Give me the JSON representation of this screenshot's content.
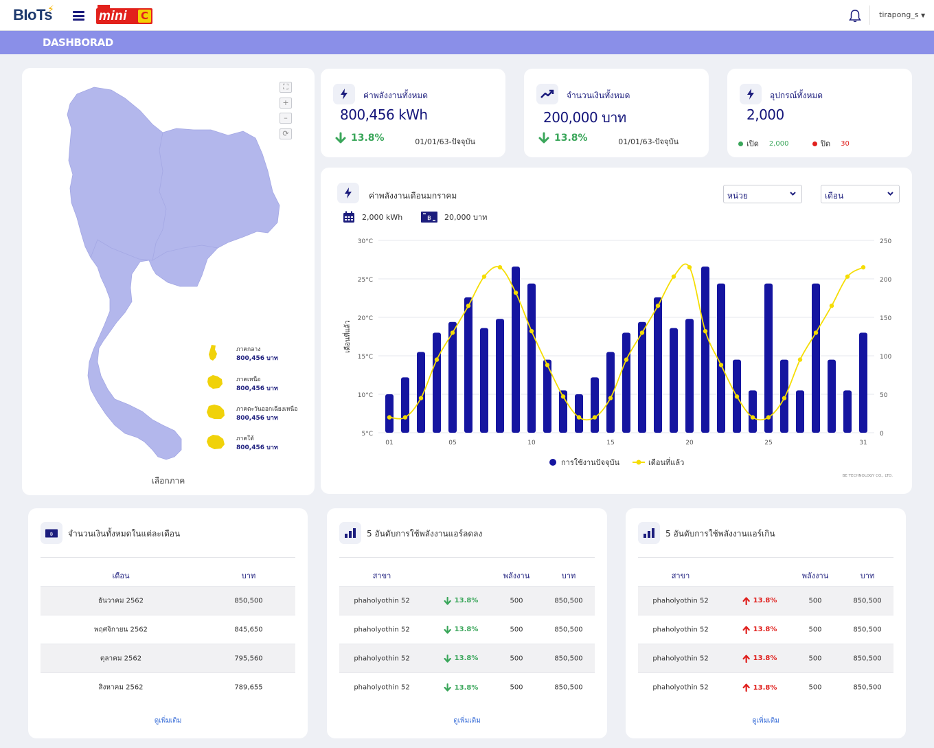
{
  "header": {
    "logo": "BIoTs",
    "brand_name": "mini",
    "brand_mark": "C",
    "username": "tirapong_s"
  },
  "section_title": "DASHBORAD",
  "map": {
    "caption": "เลือกภาค",
    "controls": [
      "⛶",
      "+",
      "–",
      "⟳"
    ],
    "regions": [
      {
        "name": "ภาคกลาง",
        "amount": "800,456 บาท"
      },
      {
        "name": "ภาคเหนือ",
        "amount": "800,456 บาท"
      },
      {
        "name": "ภาคตะวันออกเฉียงเหนือ",
        "amount": "800,456 บาท"
      },
      {
        "name": "ภาคใต้",
        "amount": "800,456 บาท"
      }
    ]
  },
  "stats": {
    "energy": {
      "label": "ค่าพลังงานทั้งหมด",
      "value": "800,456  kWh",
      "change": "13.8%",
      "period": "01/01/63-ปัจจุบัน"
    },
    "money": {
      "label": "จำนวนเงินทั้งหมด",
      "value": "200,000  บาท",
      "change": "13.8%",
      "period": "01/01/63-ปัจจุบัน"
    },
    "devices": {
      "label": "อุปกรณ์ทั้งหมด",
      "value": "2,000",
      "on_label": "เปิด",
      "on_value": "2,000",
      "off_label": "ปิด",
      "off_value": "30"
    }
  },
  "chart_panel": {
    "title": "ค่าพลังงานเดือนมกราคม",
    "unit_select": "หน่วย",
    "period_select": "เดือน",
    "summary_kwh": "2,000 kWh",
    "summary_baht": "20,000 บาท",
    "credit": "BE TECHNOLOGY CO., LTD."
  },
  "chart_data": {
    "type": "bar",
    "x_ticks": [
      "01",
      "05",
      "10",
      "15",
      "20",
      "25",
      "31"
    ],
    "x": [
      1,
      2,
      3,
      4,
      5,
      6,
      7,
      8,
      9,
      10,
      11,
      12,
      13,
      14,
      15,
      16,
      17,
      18,
      19,
      20,
      21,
      22,
      23,
      24,
      25,
      26,
      27,
      28,
      29,
      30,
      31
    ],
    "left_axis": {
      "label": "เดือนที่แล้ว",
      "ticks": [
        "5°C",
        "10°C",
        "15°C",
        "20°C",
        "25°C",
        "30°C"
      ],
      "range": [
        5,
        30
      ]
    },
    "right_axis": {
      "ticks": [
        "0",
        "50",
        "100",
        "150",
        "200",
        "250"
      ],
      "range": [
        0,
        250
      ]
    },
    "series": [
      {
        "name": "การใช้งานปัจจุบัน",
        "kind": "bar",
        "axis": "right",
        "color": "#1515a0",
        "values": [
          50,
          72,
          105,
          130,
          144,
          176,
          136,
          148,
          216,
          194,
          95,
          55,
          50,
          72,
          105,
          130,
          144,
          176,
          136,
          148,
          216,
          194,
          95,
          55,
          194,
          95,
          55,
          194,
          95,
          55,
          130
        ]
      },
      {
        "name": "เดือนที่แล้ว",
        "kind": "line",
        "axis": "right",
        "color": "#f5dd05",
        "values": [
          20,
          20,
          45,
          95,
          130,
          165,
          203,
          215,
          182,
          132,
          88,
          47,
          20,
          20,
          45,
          95,
          130,
          165,
          203,
          215,
          132,
          88,
          47,
          20,
          20,
          45,
          95,
          130,
          165,
          203,
          215
        ]
      }
    ],
    "legend_position": "bottom"
  },
  "monthly_table": {
    "title": "จำนวนเงินทั้งหมดในแต่ละเดือน",
    "columns": [
      "เดือน",
      "บาท"
    ],
    "rows": [
      [
        "ธันวาคม  2562",
        "850,500"
      ],
      [
        "พฤศจิกายน  2562",
        "845,650"
      ],
      [
        "ตุลาคม  2562",
        "795,560"
      ],
      [
        "สิงหาคม  2562",
        "789,655"
      ]
    ],
    "more": "ดูเพิ่มเติม"
  },
  "decrease_table": {
    "title": "5 อันดับการใช้พลังงานแอร์ลดลง",
    "columns": [
      "สาขา",
      "พลังงาน",
      "บาท"
    ],
    "rows": [
      [
        "phaholyothin 52",
        "13.8%",
        "500",
        "850,500"
      ],
      [
        "phaholyothin 52",
        "13.8%",
        "500",
        "850,500"
      ],
      [
        "phaholyothin 52",
        "13.8%",
        "500",
        "850,500"
      ],
      [
        "phaholyothin 52",
        "13.8%",
        "500",
        "850,500"
      ]
    ],
    "more": "ดูเพิ่มเติม"
  },
  "exceed_table": {
    "title": "5 อันดับการใช้พลังงานแอร์เกิน",
    "columns": [
      "สาขา",
      "พลังงาน",
      "บาท"
    ],
    "rows": [
      [
        "phaholyothin 52",
        "13.8%",
        "500",
        "850,500"
      ],
      [
        "phaholyothin 52",
        "13.8%",
        "500",
        "850,500"
      ],
      [
        "phaholyothin 52",
        "13.8%",
        "500",
        "850,500"
      ],
      [
        "phaholyothin 52",
        "13.8%",
        "500",
        "850,500"
      ]
    ],
    "more": "ดูเพิ่มเติม"
  },
  "colors": {
    "accent": "#8a8fe8",
    "navy": "#1c1d7d",
    "bar": "#1515a0",
    "line": "#f5dd05",
    "up": "#e0201d",
    "down": "#3aa65a",
    "region": "#f0d20a",
    "map": "#b3b7ec"
  }
}
